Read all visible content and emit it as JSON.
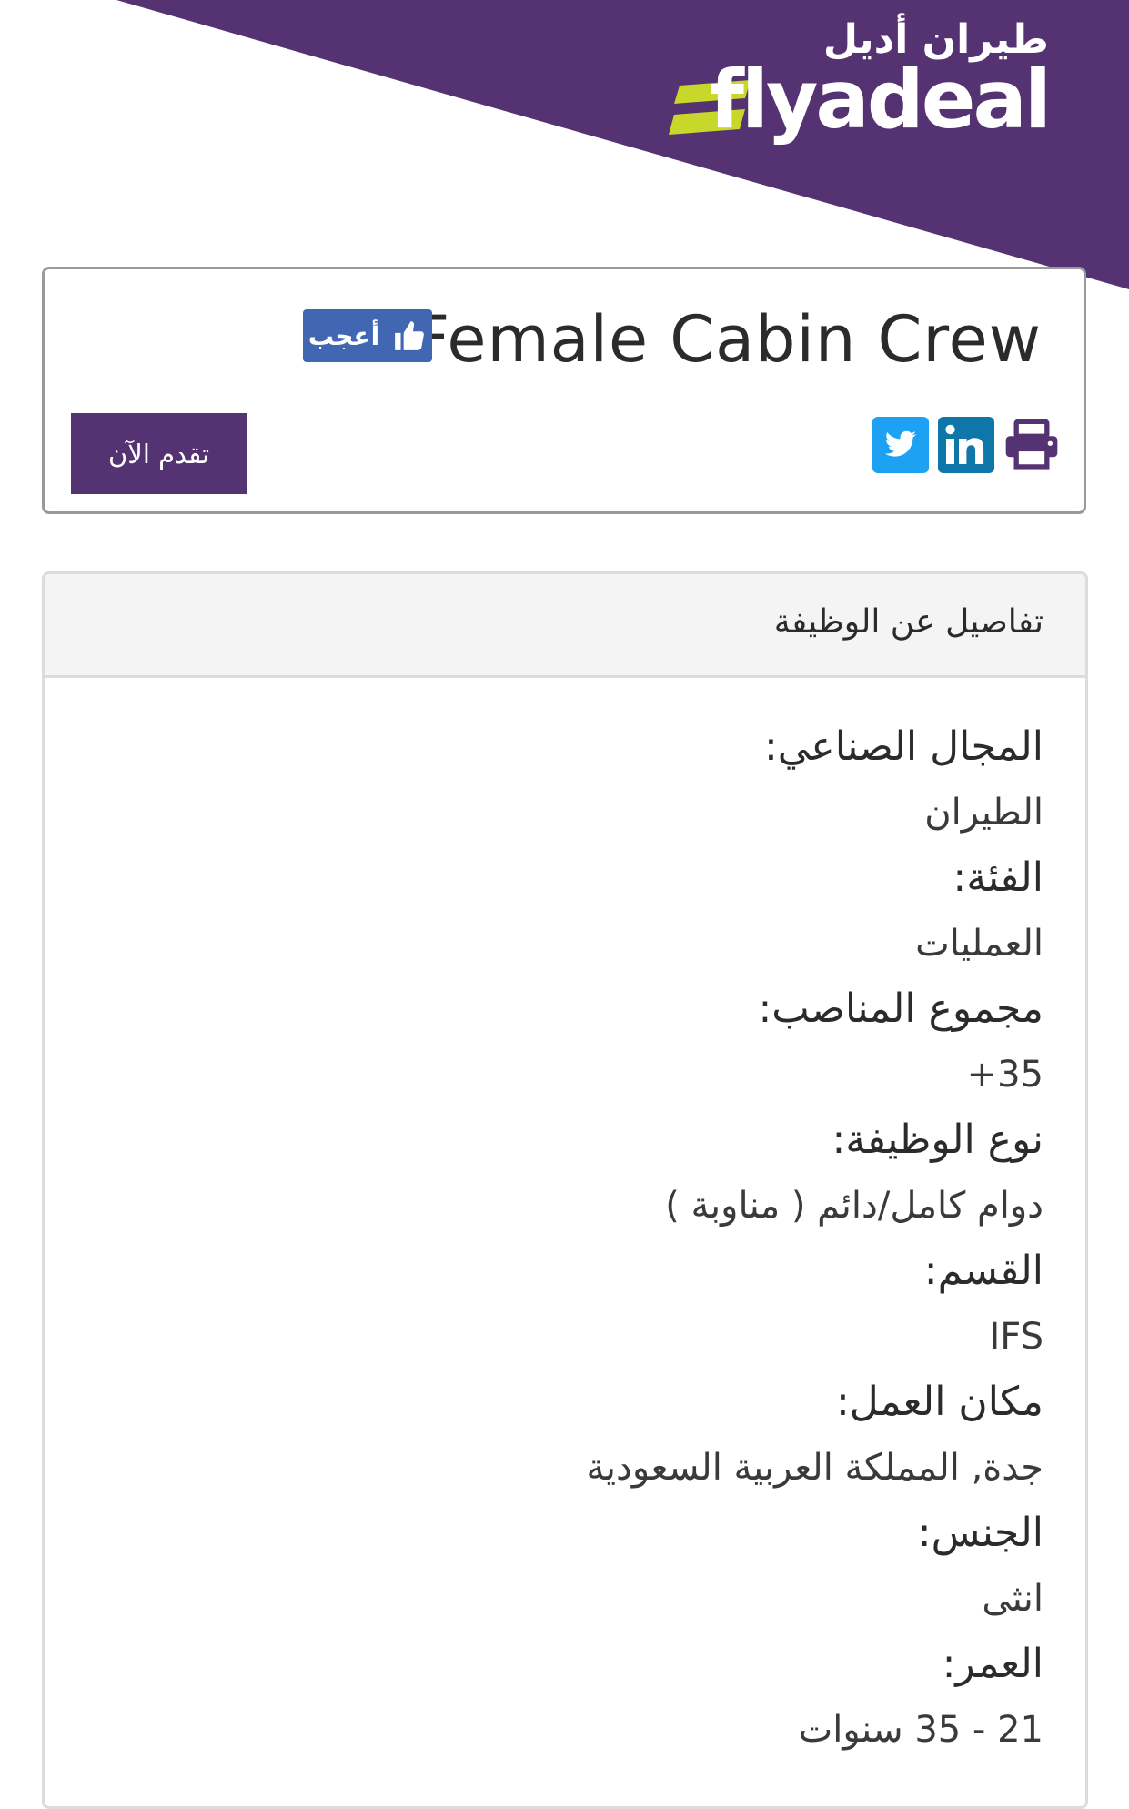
{
  "brand": {
    "arabic_name": "طيران أديل",
    "wordmark": "flyadeal",
    "purple": "#553271",
    "lime": "#c8d82b"
  },
  "job": {
    "title": "Female Cabin Crew",
    "like_label": "أعجب",
    "apply_label": "تقدم الآن",
    "share_icons": [
      "twitter-icon",
      "linkedin-icon",
      "print-icon"
    ]
  },
  "details": {
    "header": "تفاصيل عن الوظيفة",
    "fields": [
      {
        "label": "المجال الصناعي:",
        "value": "الطيران"
      },
      {
        "label": "الفئة:",
        "value": "العمليات"
      },
      {
        "label": "مجموع المناصب:",
        "value": "+35"
      },
      {
        "label": "نوع الوظيفة:",
        "value": "دوام كامل/دائم ( مناوبة )"
      },
      {
        "label": "القسم:",
        "value": "IFS"
      },
      {
        "label": "مكان العمل:",
        "value": "جدة, المملكة العربية السعودية"
      },
      {
        "label": "الجنس:",
        "value": "انثى"
      },
      {
        "label": "العمر:",
        "value": "21 - 35 سنوات"
      }
    ]
  }
}
